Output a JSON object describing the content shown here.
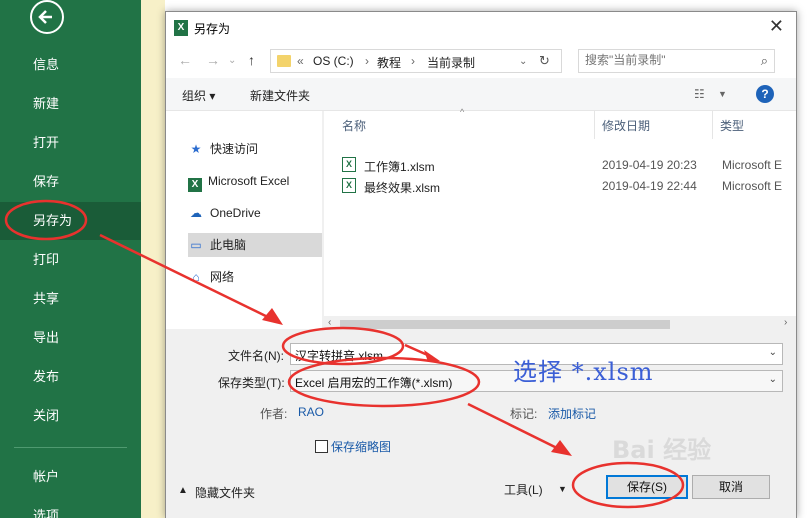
{
  "backstage": {
    "items": [
      "信息",
      "新建",
      "打开",
      "保存",
      "另存为",
      "打印",
      "共享",
      "导出",
      "发布",
      "关闭",
      "帐户",
      "选项"
    ]
  },
  "dialog": {
    "title": "另存为",
    "close_glyph": "✕",
    "address": {
      "prefix": "«",
      "parts": [
        "OS (C:)",
        "教程",
        "当前录制"
      ],
      "separator": "›"
    },
    "search_placeholder": "搜索\"当前录制\"",
    "toolbar": {
      "organize": "组织 ▾",
      "new_folder": "新建文件夹",
      "help": "?"
    },
    "tree": [
      {
        "icon": "star-icon",
        "glyph": "★",
        "label": "快速访问"
      },
      {
        "icon": "excel-icon",
        "glyph": "X",
        "label": "Microsoft Excel"
      },
      {
        "icon": "cloud-icon",
        "glyph": "☁",
        "label": "OneDrive"
      },
      {
        "icon": "computer-icon",
        "glyph": "▭",
        "label": "此电脑"
      },
      {
        "icon": "network-icon",
        "glyph": "⌂",
        "label": "网络"
      }
    ],
    "columns": {
      "name": "名称",
      "modified": "修改日期",
      "type": "类型"
    },
    "files": [
      {
        "name": "工作簿1.xlsm",
        "date": "2019-04-19 20:23",
        "type": "Microsoft E"
      },
      {
        "name": "最终效果.xlsm",
        "date": "2019-04-19 22:44",
        "type": "Microsoft E"
      }
    ],
    "form": {
      "filename_label": "文件名(N):",
      "filename_value": "汉字转拼音.xlsm",
      "filetype_label": "保存类型(T):",
      "filetype_value": "Excel 启用宏的工作簿(*.xlsm)",
      "author_label": "作者:",
      "author_value": "RAO",
      "tags_label": "标记:",
      "tags_value": "添加标记",
      "thumbnail_label": "保存缩略图",
      "hide_folders": "隐藏文件夹",
      "tools": "工具(L)",
      "save": "保存(S)",
      "cancel": "取消"
    }
  },
  "annotation": {
    "text": "选择 *.xlsm",
    "color": "#e8322e"
  },
  "watermark": {
    "text": "Bai 经验"
  }
}
